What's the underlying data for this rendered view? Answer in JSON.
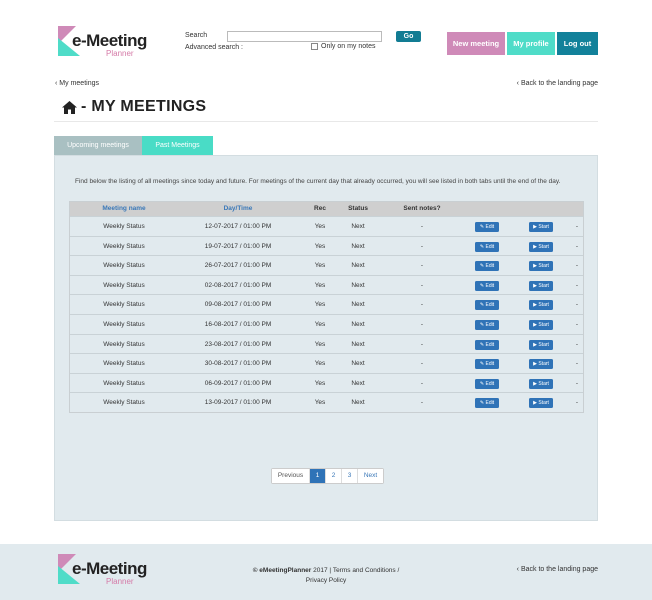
{
  "brand": {
    "name": "e-Meeting",
    "sub": "Planner"
  },
  "search": {
    "label": "Search",
    "value": "",
    "placeholder": "",
    "go": "Go",
    "advanced": "Advanced search :",
    "only_notes": "Only on my notes"
  },
  "header_buttons": {
    "new_meeting": "New meeting",
    "my_profile": "My profile",
    "logout": "Log out"
  },
  "breadcrumb": {
    "back_meetings": "My meetings",
    "back_landing": "Back to the landing page"
  },
  "page": {
    "title": "- MY MEETINGS"
  },
  "tabs": [
    {
      "label": "Upcoming meetings"
    },
    {
      "label": "Past Meetings"
    }
  ],
  "intro": "Find below the listing of all meetings since today and future. For meetings of the current day that already occurred, you will see listed in both tabs until the end of the day.",
  "table": {
    "headers": {
      "name": "Meeting name",
      "date": "Day/Time",
      "rec": "Rec",
      "status": "Status",
      "sent": "Sent notes?"
    },
    "edit_label": "Edit",
    "start_label": "Start",
    "rows": [
      {
        "name": "Weekly Status",
        "date": "12-07-2017 / 01:00 PM",
        "rec": "Yes",
        "status": "Next",
        "sent": "-",
        "extra": "-"
      },
      {
        "name": "Weekly Status",
        "date": "19-07-2017 / 01:00 PM",
        "rec": "Yes",
        "status": "Next",
        "sent": "-",
        "extra": "-"
      },
      {
        "name": "Weekly Status",
        "date": "26-07-2017 / 01:00 PM",
        "rec": "Yes",
        "status": "Next",
        "sent": "-",
        "extra": "-"
      },
      {
        "name": "Weekly Status",
        "date": "02-08-2017 / 01:00 PM",
        "rec": "Yes",
        "status": "Next",
        "sent": "-",
        "extra": "-"
      },
      {
        "name": "Weekly Status",
        "date": "09-08-2017 / 01:00 PM",
        "rec": "Yes",
        "status": "Next",
        "sent": "-",
        "extra": "-"
      },
      {
        "name": "Weekly Status",
        "date": "16-08-2017 / 01:00 PM",
        "rec": "Yes",
        "status": "Next",
        "sent": "-",
        "extra": "-"
      },
      {
        "name": "Weekly Status",
        "date": "23-08-2017 / 01:00 PM",
        "rec": "Yes",
        "status": "Next",
        "sent": "-",
        "extra": "-"
      },
      {
        "name": "Weekly Status",
        "date": "30-08-2017 / 01:00 PM",
        "rec": "Yes",
        "status": "Next",
        "sent": "-",
        "extra": "-"
      },
      {
        "name": "Weekly Status",
        "date": "06-09-2017 / 01:00 PM",
        "rec": "Yes",
        "status": "Next",
        "sent": "-",
        "extra": "-"
      },
      {
        "name": "Weekly Status",
        "date": "13-09-2017 / 01:00 PM",
        "rec": "Yes",
        "status": "Next",
        "sent": "-",
        "extra": "-"
      }
    ]
  },
  "pagination": {
    "prev": "Previous",
    "pages": [
      "1",
      "2",
      "3"
    ],
    "current": "1",
    "next": "Next"
  },
  "footer": {
    "copyright_brand": "© eMeetingPlanner",
    "year": "2017",
    "sep": "|",
    "terms": "Terms and Conditions /",
    "privacy": "Privacy Policy",
    "back_landing": "Back to the landing page"
  },
  "colors": {
    "accent_teal": "#12819a",
    "accent_mint": "#4fdcc8",
    "accent_pink": "#cf8ab8",
    "button_blue": "#2f73b7"
  },
  "icons": {
    "home": "home-icon",
    "chevron": "chevron-left-icon",
    "edit": "pencil-icon",
    "start": "play-icon"
  }
}
